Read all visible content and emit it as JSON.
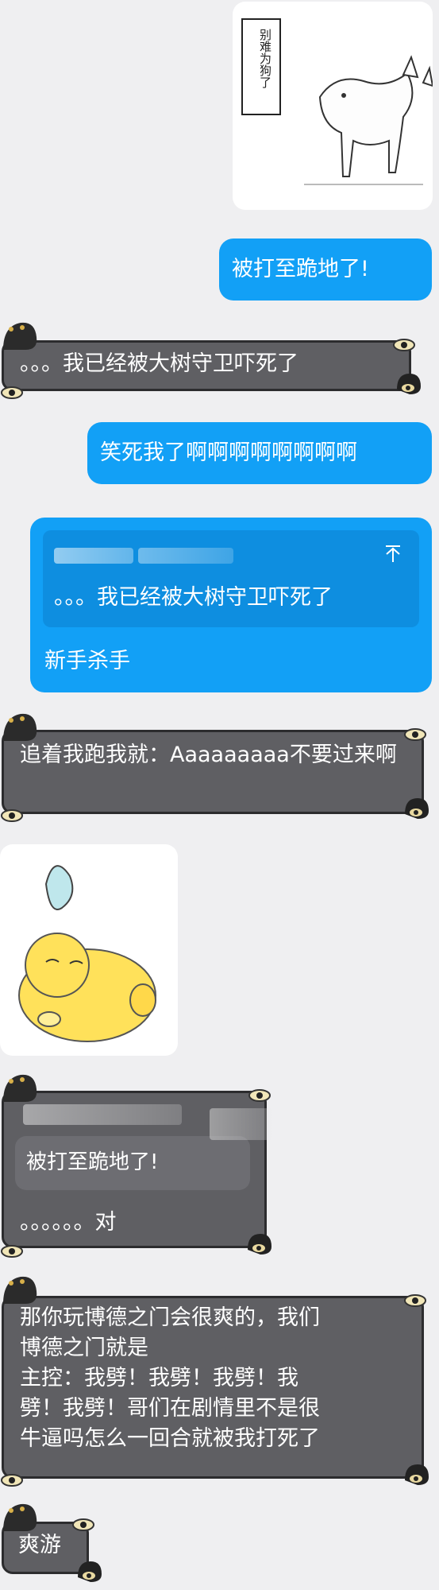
{
  "chat": {
    "msg_sticker_dog": {
      "caption": "别难为狗了"
    },
    "msg_1": {
      "text": "被打至跪地了!"
    },
    "msg_2": {
      "text": "。。。我已经被大树守卫吓死了"
    },
    "msg_3": {
      "text": "笑死我了啊啊啊啊啊啊啊啊"
    },
    "msg_4": {
      "quote_text": "。。。我已经被大树守卫吓死了",
      "quote_icon": "arrow-up-icon",
      "text": "新手杀手"
    },
    "msg_5": {
      "text": "追着我跑我就：Aaaaaaaaa不要过来啊"
    },
    "msg_sticker_chick": {},
    "msg_6": {
      "quote_text": "被打至跪地了!",
      "text": "。。。。。。对"
    },
    "msg_7": {
      "line1": "那你玩博德之门会很爽的，我们",
      "line2": "博德之门就是",
      "line3": "主控：我劈！我劈！我劈！我",
      "line4": "劈！我劈！哥们在剧情里不是很",
      "line5": "牛逼吗怎么一回合就被我打死了"
    },
    "msg_8": {
      "text": "爽游"
    }
  },
  "colors": {
    "background": "#efeff1",
    "self_bubble": "#12a0f6",
    "other_bubble": "#5f5f63"
  }
}
